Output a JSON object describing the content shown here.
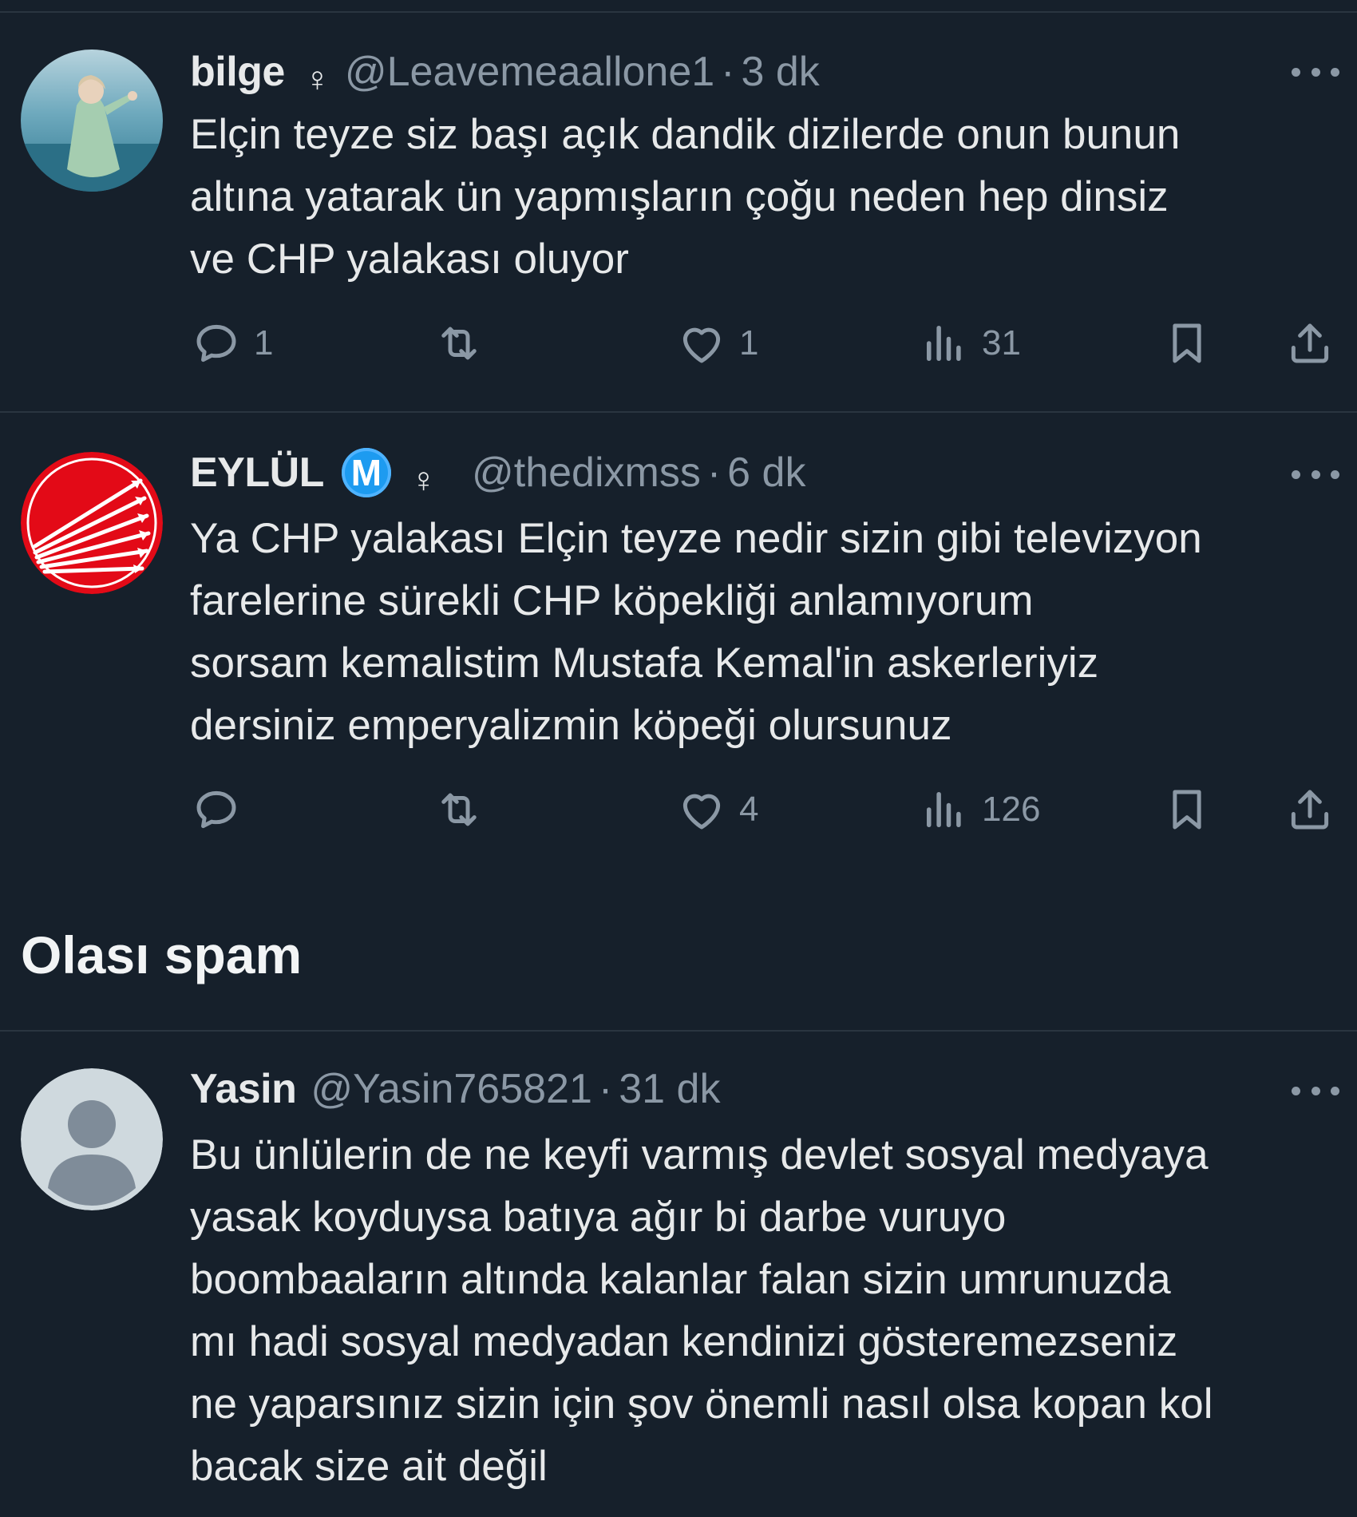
{
  "section": {
    "title": "Olası spam"
  },
  "tweets": [
    {
      "name": "bilge",
      "gender": "♀",
      "handle": "@Leavemeaallone1",
      "sep": "·",
      "time": "3 dk",
      "text": "Elçin teyze siz başı açık dandik dizilerde onun bunun\naltına yatarak ün yapmışların çoğu neden hep dinsiz\nve CHP yalakası oluyor",
      "replies": "1",
      "retweets": "",
      "likes": "1",
      "views": "31"
    },
    {
      "name": "EYLÜL",
      "verified_letter": "M",
      "gender": "♀",
      "handle": "@thedixmss",
      "sep": "·",
      "time": "6 dk",
      "text": "Ya CHP yalakası Elçin teyze nedir sizin gibi televizyon\nfarelerine sürekli CHP köpekliği anlamıyorum\nsorsam kemalistim Mustafa Kemal'in askerleriyiz\ndersiniz emperyalizmin köpeği olursunuz",
      "replies": "",
      "retweets": "",
      "likes": "4",
      "views": "126"
    },
    {
      "name": "Yasin",
      "handle": "@Yasin765821",
      "sep": "·",
      "time": "31 dk",
      "text": "Bu ünlülerin de ne keyfi varmış devlet sosyal medyaya\nyasak koyduysa batıya ağır bi darbe vuruyo\nboombaaların altında kalanlar falan sizin umrunuzda\nmı hadi sosyal medyadan kendinizi gösteremezseniz\nne yaparsınız sizin için şov önemli nasıl olsa kopan kol\nbacak size ait değil"
    }
  ],
  "colors": {
    "background": "#16202b",
    "text": "#e7e9ea",
    "muted": "#8b98a5",
    "divider": "#2a3540",
    "verified": "#1d9bf0",
    "avatar_red": "#e30a17"
  },
  "icons": {
    "reply": "reply-icon",
    "retweet": "retweet-icon",
    "like": "heart-icon",
    "views": "views-icon",
    "bookmark": "bookmark-icon",
    "share": "share-icon",
    "more": "more-icon"
  }
}
